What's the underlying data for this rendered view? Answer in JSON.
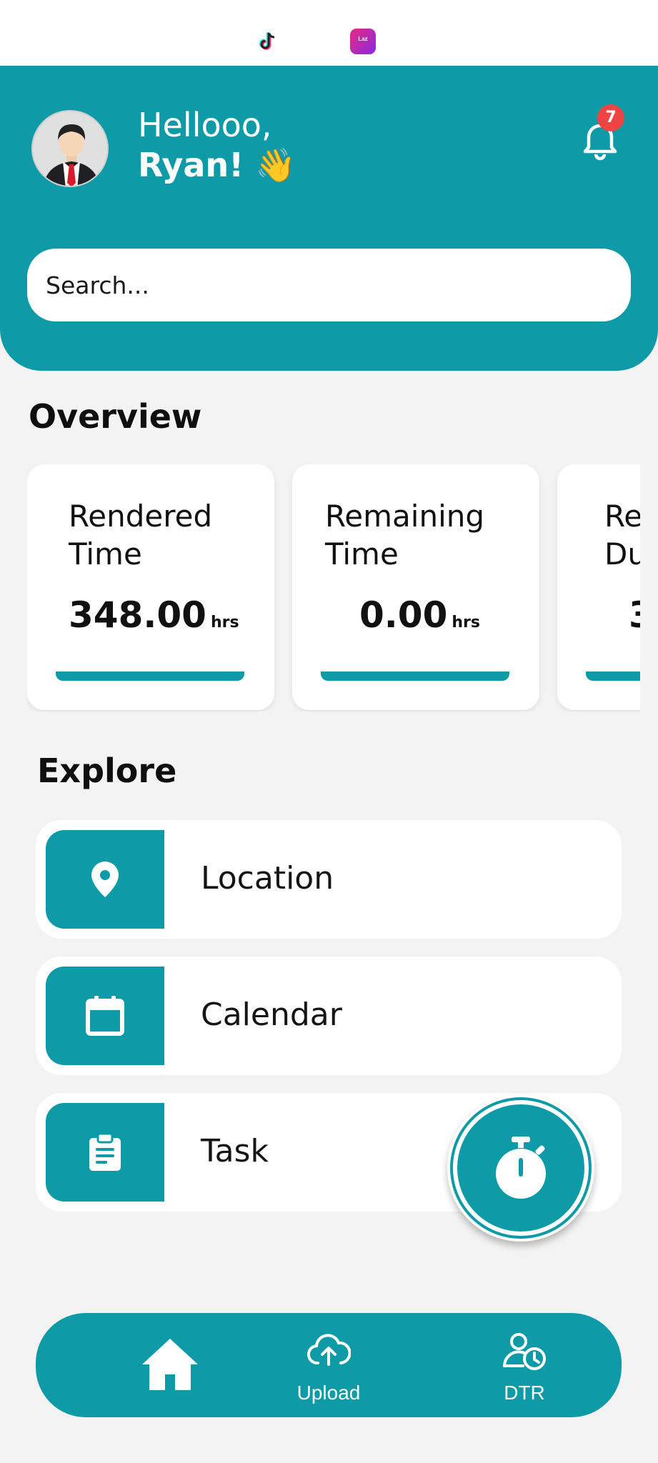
{
  "status_bar": {
    "icons": [
      "tiktok-icon",
      "lazada-icon"
    ],
    "laz_text": "Laz"
  },
  "header": {
    "greeting": "Hellooo,",
    "name": "Ryan! 👋",
    "notification_count": "7",
    "icons": [
      "avatar",
      "bell-icon"
    ]
  },
  "search": {
    "placeholder": "Search..."
  },
  "overview": {
    "title": "Overview",
    "cards": [
      {
        "label": "Rendered Time",
        "value": "348.00",
        "unit": "hrs"
      },
      {
        "label": "Remaining Time",
        "value": "0.00",
        "unit": "hrs"
      },
      {
        "label": "Re Du",
        "value": "3",
        "unit": ""
      }
    ]
  },
  "explore": {
    "title": "Explore",
    "items": [
      {
        "label": "Location",
        "icon": "location-pin-icon"
      },
      {
        "label": "Calendar",
        "icon": "calendar-icon"
      },
      {
        "label": "Task",
        "icon": "clipboard-icon"
      }
    ]
  },
  "fab": {
    "icon": "stopwatch-icon"
  },
  "bottom_nav": {
    "items": [
      {
        "label": "",
        "icon": "home-icon"
      },
      {
        "label": "Upload",
        "icon": "cloud-upload-icon"
      },
      {
        "label": "DTR",
        "icon": "user-clock-icon"
      }
    ]
  },
  "colors": {
    "accent": "#0e9aa7",
    "badge": "#ef4444",
    "background": "#f3f3f3"
  }
}
